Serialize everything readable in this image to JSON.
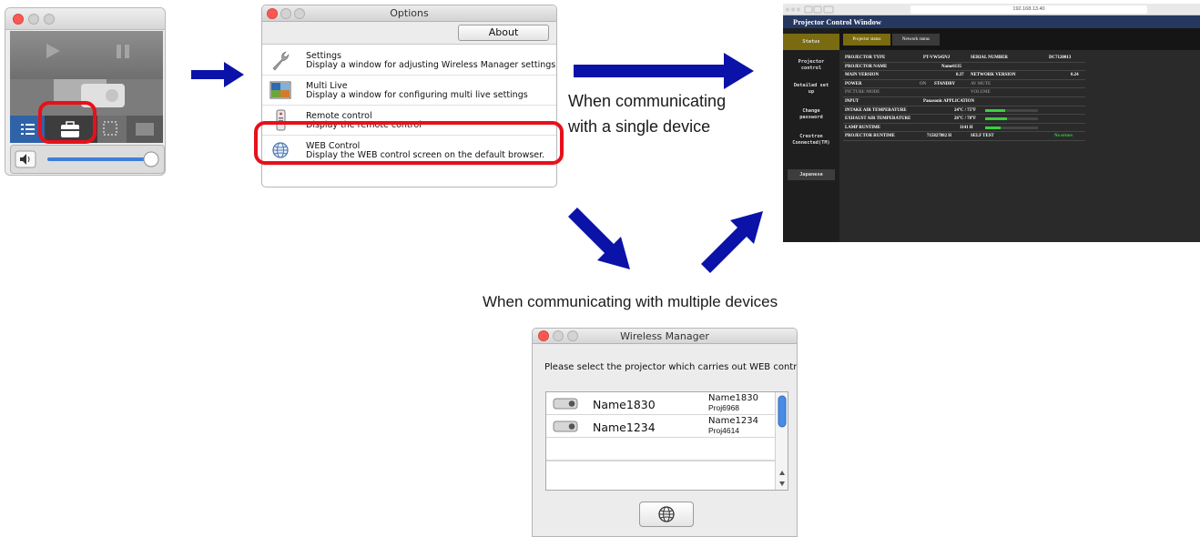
{
  "options": {
    "title": "Options",
    "about_label": "About",
    "items": [
      {
        "title": "Settings",
        "desc": "Display a window for adjusting Wireless Manager settings",
        "icon": "wrench-icon"
      },
      {
        "title": "Multi Live",
        "desc": "Display a window for configuring multi live settings",
        "icon": "multi-live-icon"
      },
      {
        "title": "Remote control",
        "desc": "Display the remote control",
        "icon": "remote-icon"
      },
      {
        "title": "WEB Control",
        "desc": "Display the WEB control screen on the default browser.",
        "icon": "globe-icon"
      }
    ]
  },
  "labels": {
    "single_line1": "When communicating",
    "single_line2": "with a single device",
    "multiple": "When communicating with multiple devices"
  },
  "control_window": {
    "url": "192.168.13.40",
    "title": "Projector Control Window",
    "side_buttons": [
      "Status",
      "Projector control",
      "Detailed set up",
      "Change password",
      "Crestron Connected(TM)",
      "Japanese"
    ],
    "tabs": [
      "Projector status",
      "Network status"
    ],
    "rows": [
      {
        "k1": "PROJECTOR TYPE",
        "v1": "PT-VW545NJ",
        "k2": "SERIAL NUMBER",
        "v2": "DC7120013"
      },
      {
        "k1": "PROJECTOR NAME",
        "v1": "Name6135",
        "k2": "",
        "v2": ""
      },
      {
        "k1": "MAIN VERSION",
        "v1": "0.37",
        "k2": "NETWORK VERSION",
        "v2": "0.24"
      },
      {
        "k1": "POWER",
        "v1": "ON",
        "v1b": "STANDBY",
        "k2": "AV MUTE",
        "v2": ""
      },
      {
        "k1": "PICTURE MODE",
        "v1": "",
        "k2": "VOLUME",
        "v2": ""
      },
      {
        "k1": "INPUT",
        "v1": "Panasonic APPLICATION",
        "k2": "",
        "v2": ""
      },
      {
        "k1": "INTAKE AIR TEMPERATURE",
        "v1": "24°C / 75°F",
        "k2": "",
        "v2": "",
        "bar": 0.38
      },
      {
        "k1": "EXHAUST AIR TEMPERATURE",
        "v1": "26°C / 78°F",
        "k2": "",
        "v2": "",
        "bar": 0.42
      },
      {
        "k1": "LAMP RUNTIME",
        "v1": "1141 H",
        "k2": "",
        "v2": "",
        "bar": 0.3
      },
      {
        "k1": "PROJECTOR RUNTIME",
        "v1": "715827882 H",
        "k2": "SELF TEST",
        "v2": "No errors"
      }
    ]
  },
  "device_list": {
    "title": "Wireless Manager",
    "prompt": "Please select the projector which carries out WEB contro",
    "devices": [
      {
        "name": "Name1830",
        "detail1": "Name1830",
        "detail2": "Proj6968"
      },
      {
        "name": "Name1234",
        "detail1": "Name1234",
        "detail2": "Proj4614"
      }
    ]
  },
  "colors": {
    "arrow": "#0b12a8",
    "highlight": "#e8101a",
    "status_bar": "#36d13c",
    "tab_active": "#7a6a10"
  }
}
